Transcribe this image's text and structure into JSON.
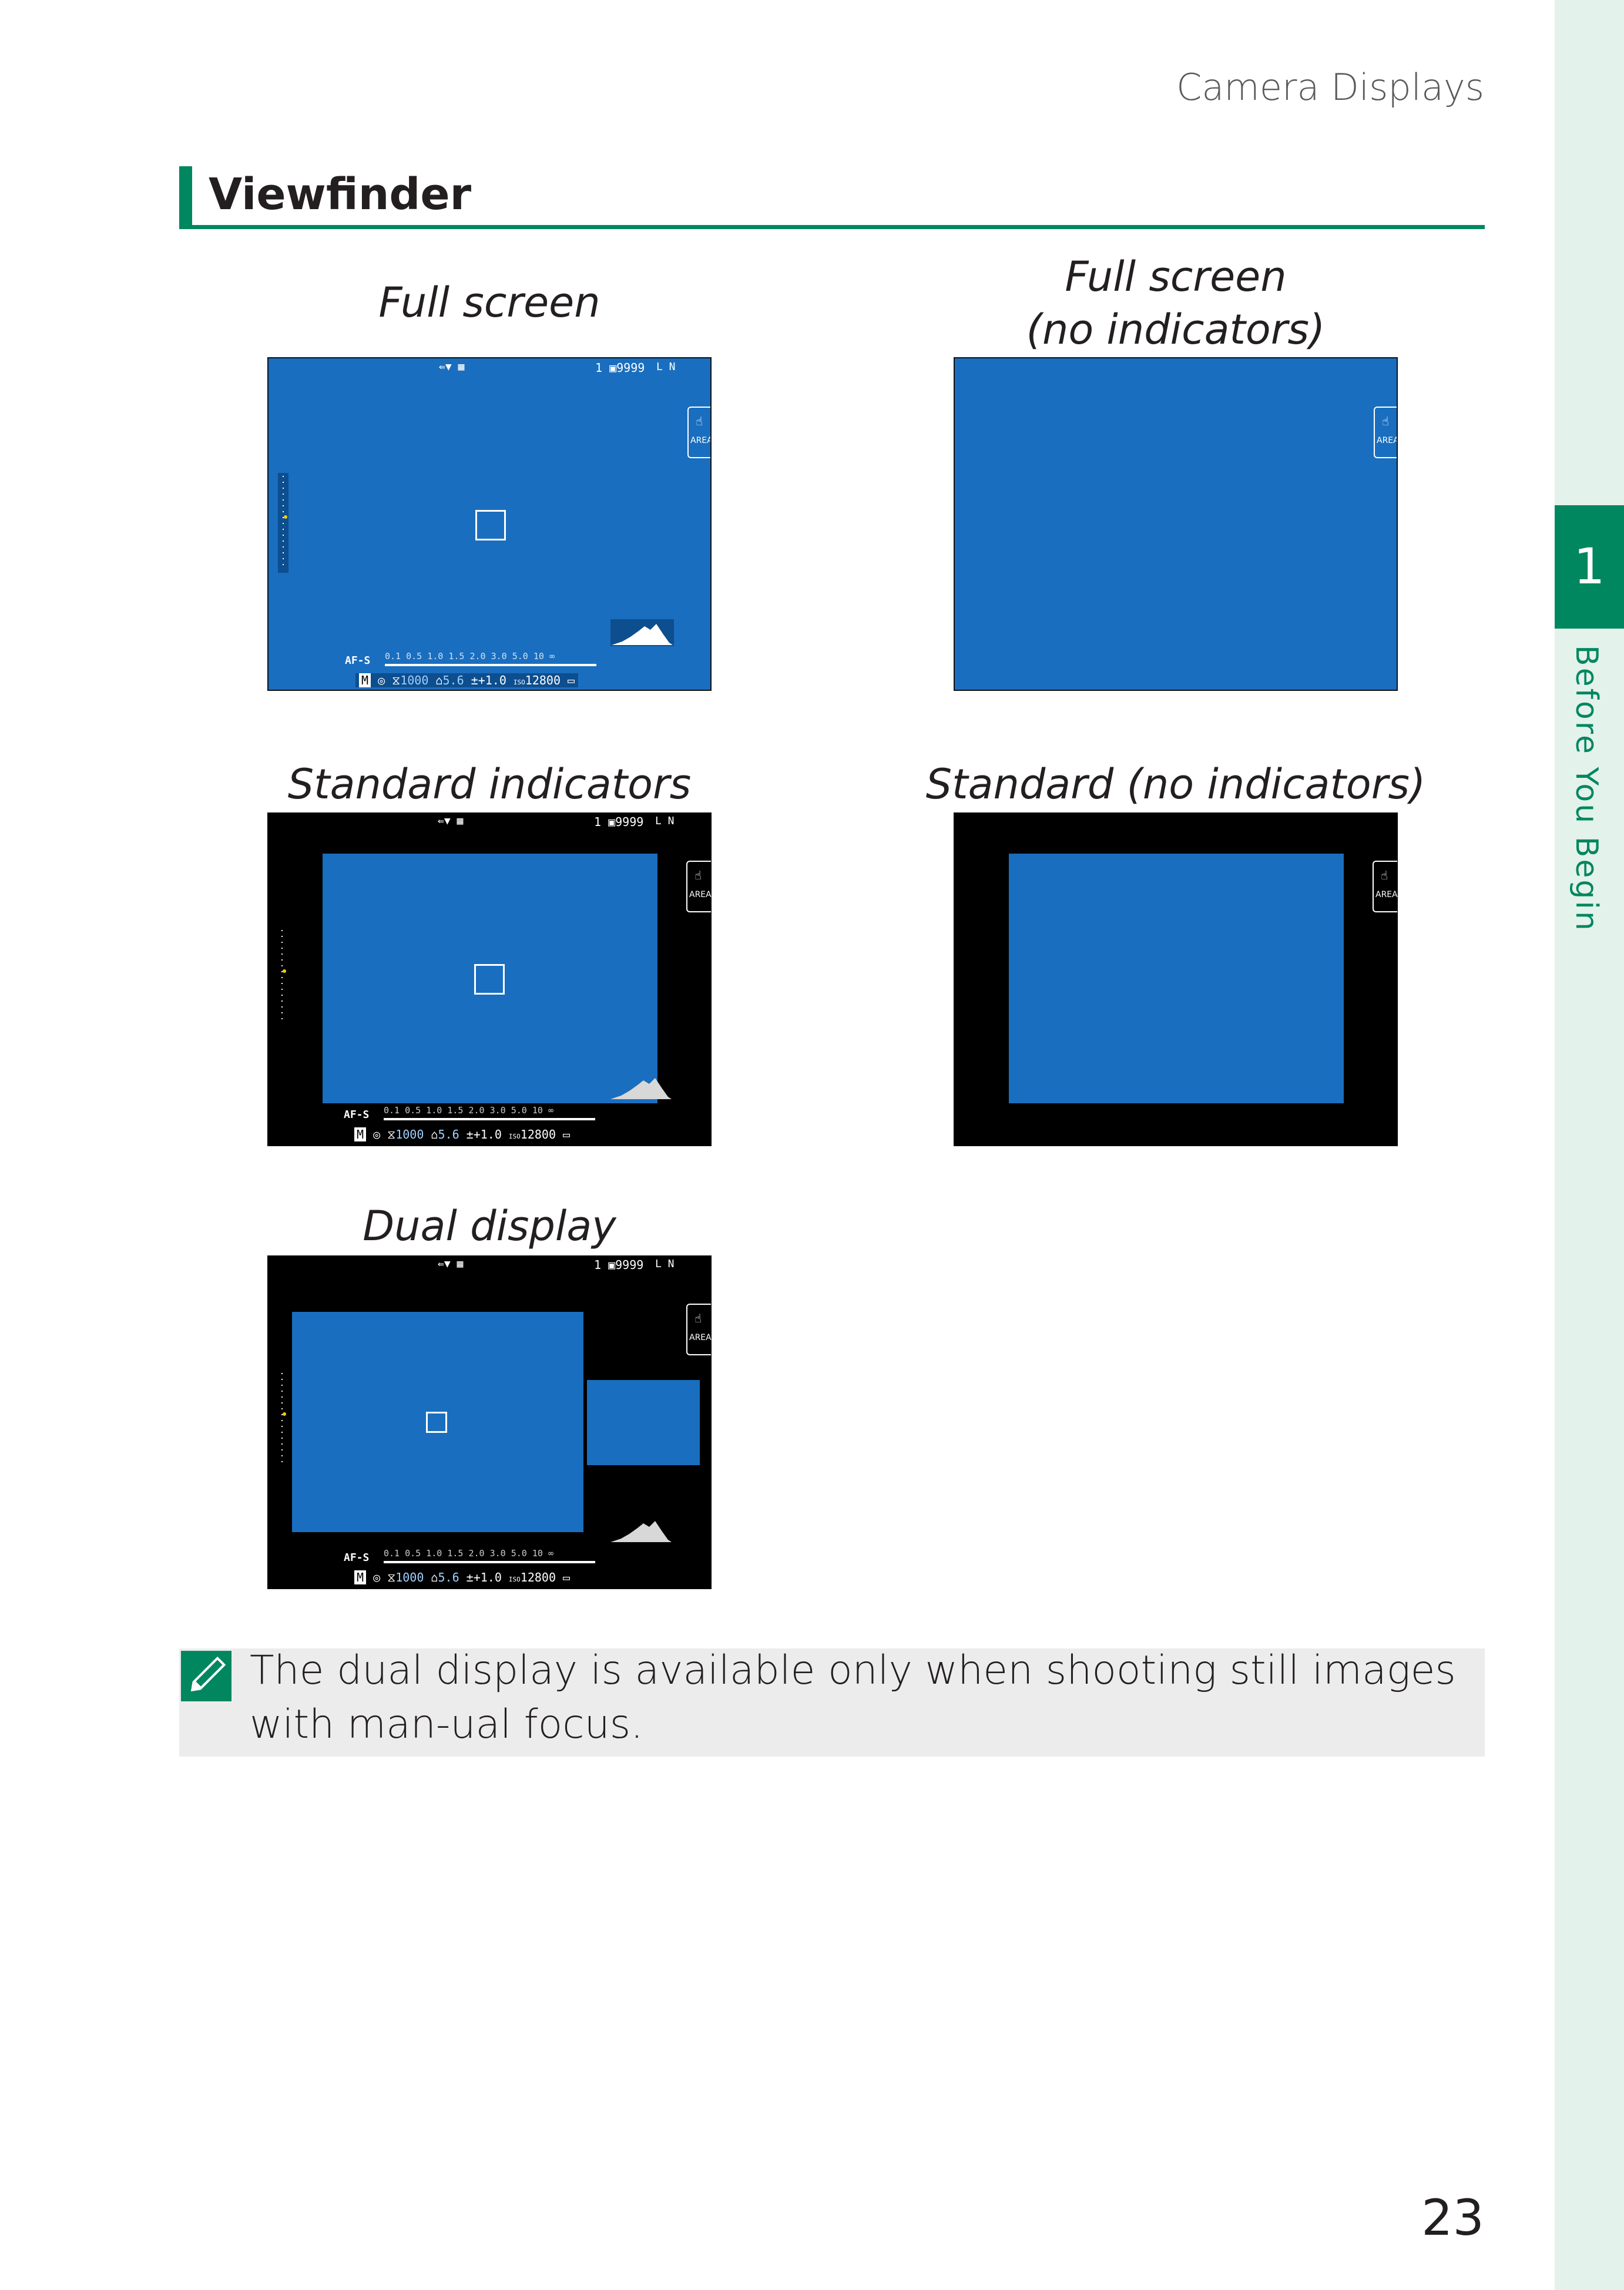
{
  "header": {
    "title": "Camera Displays"
  },
  "section": {
    "title": "Viewfinder"
  },
  "chapter": {
    "number": "1",
    "label": "Before You Begin"
  },
  "captions": {
    "full_screen": "Full screen",
    "full_screen_no_ind_line1": "Full screen",
    "full_screen_no_ind_line2": "(no indicators)",
    "standard_indicators": "Standard indicators",
    "standard_no_indicators": "Standard (no indicators)",
    "dual_display": "Dual display"
  },
  "screen_labels": {
    "frames": "1 ▣9999",
    "quality": "L N",
    "focus_mode": "AF-S",
    "mode": "M",
    "distance": "0.1 0.5   1.0   1.5   2.0   3.0  5.0  10 ∞",
    "shutter": "1000",
    "aperture": "5.6",
    "exposure_comp": "+1.0",
    "iso_prefix": "ISO",
    "iso": "12800",
    "area": "AREA"
  },
  "note": {
    "text": "The dual display is available only when shooting still images with man-ual focus."
  },
  "page_number": "23",
  "colors": {
    "accent": "#00875f",
    "screen_blue": "#1a6ebf",
    "side_strip": "#e4f2ec"
  }
}
